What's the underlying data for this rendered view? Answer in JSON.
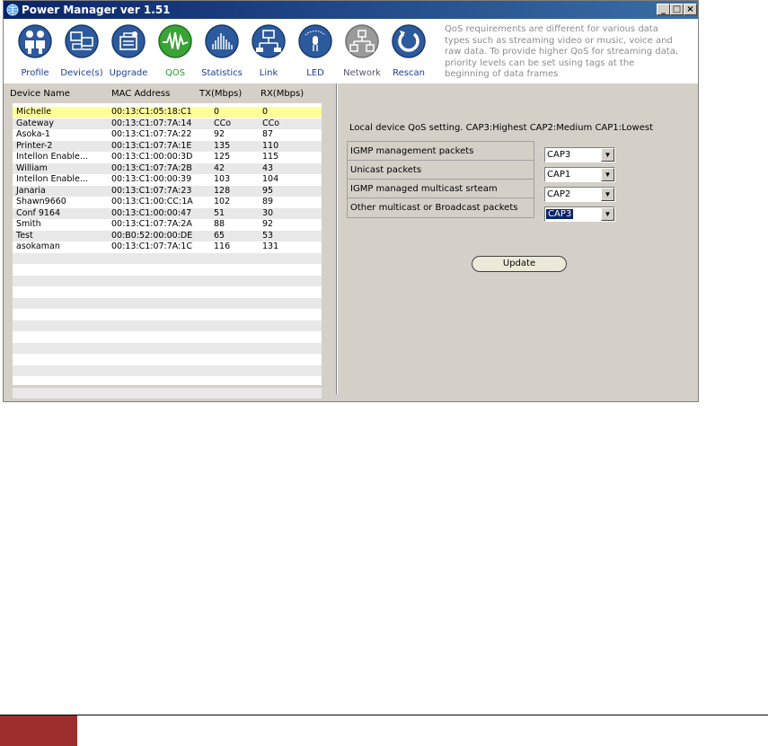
{
  "window": {
    "title": "Power Manager ver 1.51",
    "controls": {
      "minimize": "_",
      "maximize": "□",
      "close": "×"
    }
  },
  "toolbar": {
    "items": [
      {
        "label": "Profile",
        "icon": "people-icon",
        "color": "#2c5a9c"
      },
      {
        "label": "Device(s)",
        "icon": "computers-icon",
        "color": "#2c5a9c"
      },
      {
        "label": "Upgrade",
        "icon": "upgrade-icon",
        "color": "#2c5a9c"
      },
      {
        "label": "QOS",
        "icon": "waveform-icon",
        "color": "#3aa335"
      },
      {
        "label": "Statistics",
        "icon": "bars-icon",
        "color": "#2c5a9c"
      },
      {
        "label": "Link",
        "icon": "link-icon",
        "color": "#2c5a9c"
      },
      {
        "label": "LED",
        "icon": "bulb-icon",
        "color": "#2c5a9c"
      },
      {
        "label": "Network",
        "icon": "network-icon",
        "color": "#9a9a9a"
      },
      {
        "label": "Rescan",
        "icon": "refresh-icon",
        "color": "#2c5a9c"
      }
    ],
    "info": "QoS requirements are different for various data types such as streaming video or music, voice and raw data. To provide higher QoS for streaming data, priority levels can be set using tags at the beginning of data frames"
  },
  "devices": {
    "headers": {
      "name": "Device Name",
      "mac": "MAC Address",
      "tx": "TX(Mbps)",
      "rx": "RX(Mbps)"
    },
    "rows": [
      {
        "name": "Michelle",
        "mac": "00:13:C1:05:18:C1",
        "tx": "0",
        "rx": "0"
      },
      {
        "name": "Gateway",
        "mac": "00:13:C1:07:7A:14",
        "tx": "CCo",
        "rx": "CCo"
      },
      {
        "name": "Asoka-1",
        "mac": "00:13:C1:07:7A:22",
        "tx": "92",
        "rx": "87"
      },
      {
        "name": "Printer-2",
        "mac": "00:13:C1:07:7A:1E",
        "tx": "135",
        "rx": "110"
      },
      {
        "name": "Intellon Enable...",
        "mac": "00:13:C1:00:00:3D",
        "tx": "125",
        "rx": "115"
      },
      {
        "name": "William",
        "mac": "00:13:C1:07:7A:2B",
        "tx": "42",
        "rx": "43"
      },
      {
        "name": "Intellon Enable...",
        "mac": "00:13:C1:00:00:39",
        "tx": "103",
        "rx": "104"
      },
      {
        "name": "Janaria",
        "mac": "00:13:C1:07:7A:23",
        "tx": "128",
        "rx": "95"
      },
      {
        "name": "Shawn9660",
        "mac": "00:13:C1:00:CC:1A",
        "tx": "102",
        "rx": "89"
      },
      {
        "name": "Conf 9164",
        "mac": "00:13:C1:00:00:47",
        "tx": "51",
        "rx": "30"
      },
      {
        "name": "Smith",
        "mac": "00:13:C1:07:7A:2A",
        "tx": "88",
        "rx": "92"
      },
      {
        "name": "Test",
        "mac": "00:B0:52:00:00:DE",
        "tx": "65",
        "rx": "53"
      },
      {
        "name": "asokaman",
        "mac": "00:13:C1:07:7A:1C",
        "tx": "116",
        "rx": "131"
      }
    ],
    "selected_index": 0
  },
  "qos": {
    "title": "Local device QoS setting. CAP3:Highest CAP2:Medium CAP1:Lowest",
    "settings": [
      {
        "label": "IGMP management packets",
        "value": "CAP3"
      },
      {
        "label": "Unicast packets",
        "value": "CAP1"
      },
      {
        "label": "IGMP managed multicast srteam",
        "value": "CAP2"
      },
      {
        "label": "Other multicast or Broadcast packets",
        "value": "CAP3"
      }
    ],
    "update_label": "Update"
  }
}
